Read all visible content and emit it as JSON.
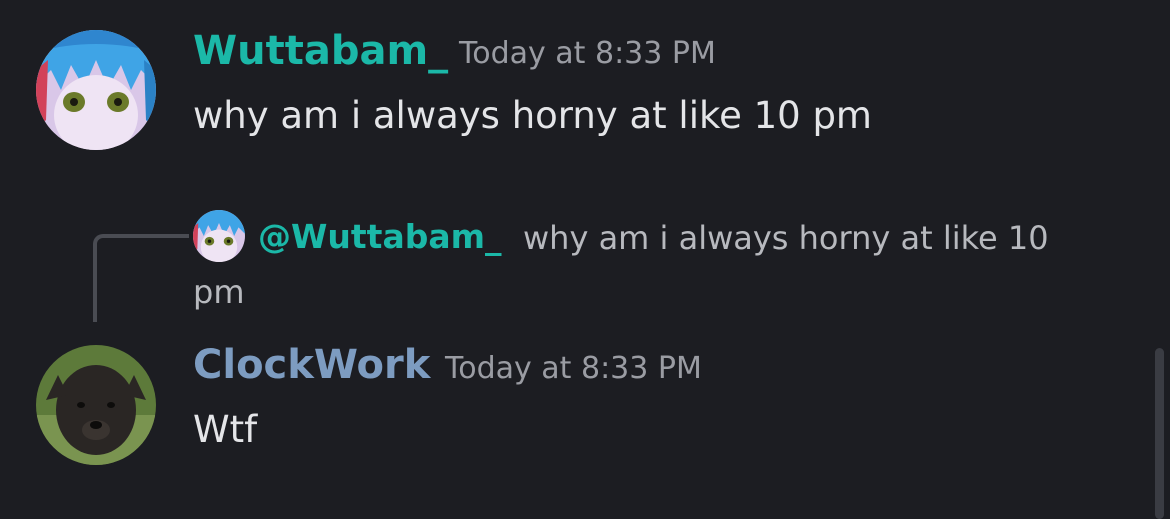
{
  "messages": [
    {
      "username": "Wuttabam_",
      "timestamp": "Today at 8:33 PM",
      "content": "why am i always horny at like 10 pm",
      "name_color": "#1bb8a8",
      "avatar_icon": "anime-avatar"
    },
    {
      "username": "ClockWork",
      "timestamp": "Today at 8:33 PM",
      "content": "Wtf",
      "name_color": "#7d9cc1",
      "avatar_icon": "dog-avatar",
      "reply": {
        "mention": "@Wuttabam_",
        "text_line1": "why am i always horny at like 10",
        "text_line2": "pm",
        "avatar_icon": "anime-avatar"
      }
    }
  ],
  "colors": {
    "background": "#1c1d22",
    "text": "#e4e5e8",
    "muted": "#9a9ca3",
    "reply_line": "#4a4c53",
    "scrollbar": "#3a3c43"
  }
}
